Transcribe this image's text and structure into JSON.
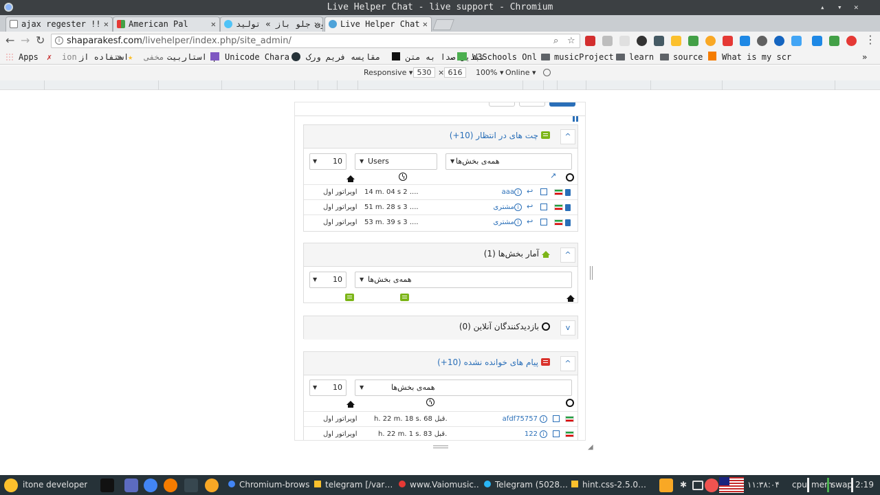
{
  "window": {
    "title": "Live Helper Chat - live support - Chromium",
    "min": "▴",
    "max": "▾",
    "close": "✕"
  },
  "tabs": [
    {
      "label": "ajax regester !!",
      "close": "✕"
    },
    {
      "label": "American Pal",
      "close": "✕"
    },
    {
      "label": "مانوی جلو باز » تولید",
      "close": "✕"
    },
    {
      "label": "Live Helper Chat",
      "close": "✕"
    }
  ],
  "toolbar": {
    "back": "←",
    "forward": "→",
    "reload": "↻",
    "url_host": "shaparakesf.com",
    "url_path": "/livehelper/index.php/site_admin/",
    "info": "i",
    "search": "⌕",
    "star": "☆",
    "menu": "⋮"
  },
  "bookmarks": {
    "apps": "Apps",
    "items": [
      "ion",
      "استفاده از",
      "»",
      "مخفی",
      "استاربیت |",
      "Unicode Chara",
      "مقایسه فریم ورک",
      "تبدیل صدا به متن",
      "W3Schools Onl",
      "musicProject",
      "learn",
      "source",
      "What is my scr"
    ],
    "more": "»"
  },
  "devtools": {
    "mode": "Responsive",
    "width": "530",
    "times": "×",
    "height": "616",
    "zoom": "100%",
    "throttle": "Online"
  },
  "panels": {
    "pending": {
      "title": "چت های در انتظار (10+)",
      "toggle": "^",
      "limit": "10",
      "user_filter": "Users",
      "dept_filter": "همه‌ی بخش‌ها",
      "rows": [
        {
          "nick": "aaa",
          "time": "14 m. 04 s 2 ....",
          "operator": "اویراتور اول"
        },
        {
          "nick": "مشتری",
          "time": "51 m. 28 s 3 ....",
          "operator": "اویراتور اول"
        },
        {
          "nick": "مشتری",
          "time": "53 m. 39 s 3 ....",
          "operator": "اویراتور اول"
        }
      ]
    },
    "departments": {
      "title": "آمار بخش‌ها (1)",
      "toggle": "^",
      "limit": "10",
      "dept_filter": "همه‌ی بخش‌ها"
    },
    "visitors": {
      "title": "بازدیدکنندگان آنلاین (0)",
      "toggle": "v"
    },
    "unread": {
      "title": "پیام های خوانده نشده (10+)",
      "toggle": "^",
      "limit": "10",
      "dept_filter": "همه‌ی بخش‌ها",
      "rows": [
        {
          "nick": "afdf75757",
          "time": "h. 22 m. 18 s. 68 قبل.",
          "operator": "اویراتور اول"
        },
        {
          "nick": "122",
          "time": "h. 22 m. 1 s. 83 قبل.",
          "operator": "اویراتور اول"
        }
      ]
    }
  },
  "taskbar": {
    "start": "itone developer",
    "apps": [
      "Chromium-brows…",
      "telegram [/var…",
      "www.Vaiomusic.…",
      "Telegram (5028…",
      "hint.css-2.5.0…"
    ],
    "clock_fa": "۱۱:۳۸:۰۴",
    "cpu": "cpu",
    "mem": "mem",
    "swap": "swap",
    "time": "2:19"
  },
  "colors": {
    "link": "#2a6fb8",
    "green_icon": "#7cb518",
    "red_icon": "#d9322b",
    "taskbar": "#263238"
  }
}
